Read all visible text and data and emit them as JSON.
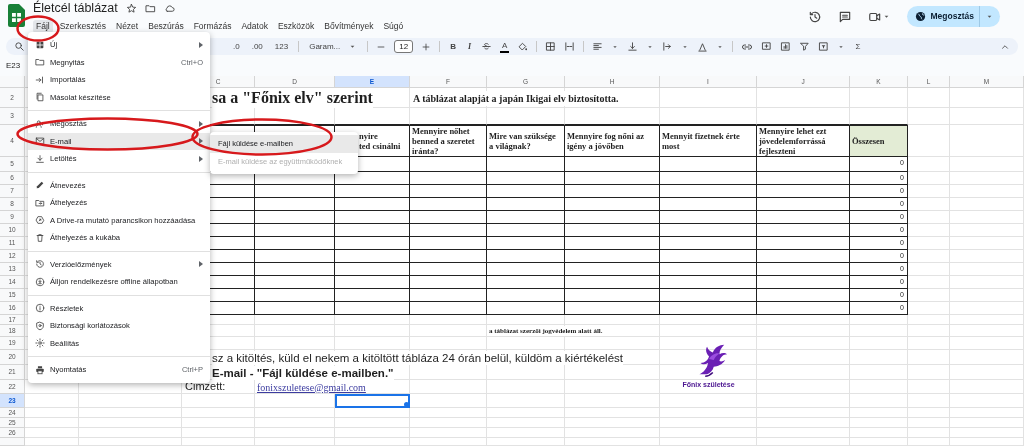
{
  "document": {
    "title": "Életcél táblázat"
  },
  "menu_bar": [
    {
      "label": "Fájl",
      "selected": true
    },
    {
      "label": "Szerkesztés",
      "selected": false
    },
    {
      "label": "Nézet",
      "selected": false
    },
    {
      "label": "Beszúrás",
      "selected": false
    },
    {
      "label": "Formázás",
      "selected": false
    },
    {
      "label": "Adatok",
      "selected": false
    },
    {
      "label": "Eszközök",
      "selected": false
    },
    {
      "label": "Bővítmények",
      "selected": false
    },
    {
      "label": "Súgó",
      "selected": false
    }
  ],
  "share_button": {
    "label": "Megosztás"
  },
  "toolbar": {
    "decimals": [
      ".0",
      ".00"
    ],
    "number_format": "123",
    "font": "Garam...",
    "font_size": "12",
    "bold": "B",
    "italic": "I",
    "text_color": "A",
    "function": "Σ"
  },
  "name_box": "E23",
  "columns": [
    {
      "label": "C",
      "selected": false
    },
    {
      "label": "D",
      "selected": false
    },
    {
      "label": "E",
      "selected": true
    },
    {
      "label": "F",
      "selected": false
    },
    {
      "label": "G",
      "selected": false
    },
    {
      "label": "H",
      "selected": false
    },
    {
      "label": "I",
      "selected": false
    },
    {
      "label": "J",
      "selected": false
    },
    {
      "label": "K",
      "selected": false
    },
    {
      "label": "L",
      "selected": false
    },
    {
      "label": "M",
      "selected": false
    }
  ],
  "rows": [
    {
      "label": "2",
      "selected": false
    },
    {
      "label": "3",
      "selected": false
    },
    {
      "label": "4",
      "selected": false
    },
    {
      "label": "5",
      "selected": false
    },
    {
      "label": "6",
      "selected": false
    },
    {
      "label": "7",
      "selected": false
    },
    {
      "label": "8",
      "selected": false
    },
    {
      "label": "9",
      "selected": false
    },
    {
      "label": "10",
      "selected": false
    },
    {
      "label": "11",
      "selected": false
    },
    {
      "label": "12",
      "selected": false
    },
    {
      "label": "13",
      "selected": false
    },
    {
      "label": "14",
      "selected": false
    },
    {
      "label": "15",
      "selected": false
    },
    {
      "label": "16",
      "selected": false
    },
    {
      "label": "17",
      "selected": false
    },
    {
      "label": "18",
      "selected": false
    },
    {
      "label": "19",
      "selected": false
    },
    {
      "label": "20",
      "selected": false
    },
    {
      "label": "21",
      "selected": false
    },
    {
      "label": "22",
      "selected": false
    },
    {
      "label": "23",
      "selected": true
    },
    {
      "label": "24",
      "selected": false
    },
    {
      "label": "25",
      "selected": false
    },
    {
      "label": "26",
      "selected": false
    }
  ],
  "sheet": {
    "heading": "sa a \"Főnix elv\" szerint",
    "subtitle": "A táblázat alapját a japán Ikigai elv biztosította.",
    "headers": [
      {
        "text": "nyire\nted csinálni",
        "kind": "question"
      },
      {
        "text": "Mennyire nőhet benned a szeretet iránta?",
        "kind": "question"
      },
      {
        "text": "Mire van szüksége a világnak?",
        "kind": "question"
      },
      {
        "text": "Mennyire fog nőni az igény a jövőben",
        "kind": "question"
      },
      {
        "text": "Mennyit fizetnek érte most",
        "kind": "question"
      },
      {
        "text": "Mennyire lehet ezt jövedelemforrássá fejleszteni",
        "kind": "question"
      },
      {
        "text": "Összesen",
        "kind": "total"
      }
    ],
    "totals": [
      "0",
      "0",
      "0",
      "0",
      "0",
      "0",
      "0",
      "0",
      "0",
      "0",
      "0",
      "0"
    ],
    "copyright": "a táblázat szerzői jogvédelem alatt áll.",
    "instructions": [
      "sz a kitöltés, küld el nekem a kitöltött tábláza 24 órán belül, küldöm a kiértékelést",
      "E-mail - \"Fájl küldése e-mailben.\""
    ],
    "recipient_label": "Cimzett:",
    "recipient_email": "fonixszuletese@gmail.com",
    "logo_caption": "Főnix születése"
  },
  "file_menu": {
    "items": [
      {
        "kind": "item",
        "label": "Új",
        "submenu": true,
        "selected": false
      },
      {
        "kind": "item",
        "label": "Megnyitás",
        "shortcut": "Ctrl+O",
        "submenu": false,
        "selected": false
      },
      {
        "kind": "item",
        "label": "Importálás",
        "submenu": false,
        "selected": false
      },
      {
        "kind": "item",
        "label": "Másolat készítése",
        "submenu": false,
        "selected": false
      },
      {
        "kind": "separator"
      },
      {
        "kind": "item",
        "label": "Megosztás",
        "submenu": true,
        "selected": false
      },
      {
        "kind": "item",
        "label": "E-mail",
        "submenu": true,
        "selected": true
      },
      {
        "kind": "item",
        "label": "Letöltés",
        "submenu": true,
        "selected": false
      },
      {
        "kind": "separator"
      },
      {
        "kind": "item",
        "label": "Átnevezés",
        "submenu": false,
        "selected": false
      },
      {
        "kind": "item",
        "label": "Áthelyezés",
        "submenu": false,
        "selected": false
      },
      {
        "kind": "item",
        "label": "A Drive-ra mutató parancsikon hozzáadása",
        "submenu": false,
        "selected": false
      },
      {
        "kind": "item",
        "label": "Áthelyezés a kukába",
        "submenu": false,
        "selected": false
      },
      {
        "kind": "separator"
      },
      {
        "kind": "item",
        "label": "Verzióelőzmények",
        "submenu": true,
        "selected": false
      },
      {
        "kind": "item",
        "label": "Álljon rendelkezésre offline állapotban",
        "submenu": false,
        "selected": false
      },
      {
        "kind": "separator"
      },
      {
        "kind": "item",
        "label": "Részletek",
        "submenu": false,
        "selected": false
      },
      {
        "kind": "item",
        "label": "Biztonsági korlátozások",
        "submenu": false,
        "selected": false
      },
      {
        "kind": "item",
        "label": "Beállítás",
        "submenu": false,
        "selected": false
      },
      {
        "kind": "separator"
      },
      {
        "kind": "item",
        "label": "Nyomtatás",
        "shortcut": "Ctrl+P",
        "submenu": false,
        "selected": false
      }
    ]
  },
  "email_submenu": [
    {
      "label": "Fájl küldése e-mailben",
      "selected": true,
      "disabled": false
    },
    {
      "label": "E-mail küldése az együttműködőknek",
      "selected": false,
      "disabled": true
    }
  ]
}
